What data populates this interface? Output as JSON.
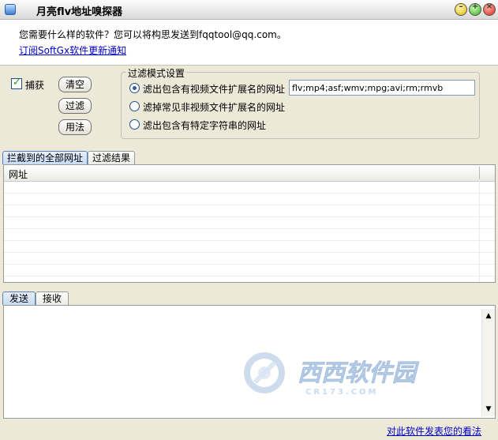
{
  "window": {
    "title": "月亮flv地址嗅探器"
  },
  "top": {
    "prompt": "您需要什么样的软件？您可以将构思发送到fqqtool@qq.com。",
    "subscribe_link": "订阅SoftGx软件更新通知"
  },
  "controls": {
    "capture_label": "捕获",
    "capture_checked": true,
    "clear_label": "清空",
    "filter_label": "过滤",
    "usage_label": "用法"
  },
  "filter_mode": {
    "legend": "过滤模式设置",
    "options": [
      {
        "label": "滤出包含有视频文件扩展名的网址",
        "selected": true
      },
      {
        "label": "滤掉常见非视频文件扩展名的网址",
        "selected": false
      },
      {
        "label": "滤出包含有特定字符串的网址",
        "selected": false
      }
    ],
    "extensions_value": "flv;mp4;asf;wmv;mpg;avi;rm;rmvb"
  },
  "url_tabs": [
    {
      "label": "拦截到的全部网址",
      "active": true
    },
    {
      "label": "过滤结果",
      "active": false
    }
  ],
  "url_table": {
    "column_header": "网址"
  },
  "io_tabs": [
    {
      "label": "发送",
      "active": true
    },
    {
      "label": "接收",
      "active": false
    }
  ],
  "watermark": {
    "brand": "西西软件园",
    "domain": "CR173.COM"
  },
  "footer": {
    "feedback_link": "对此软件发表您的看法"
  },
  "colors": {
    "link": "#0000cc",
    "panel_bg": "#ece9d8",
    "tab_active": "#c6dbf3"
  }
}
